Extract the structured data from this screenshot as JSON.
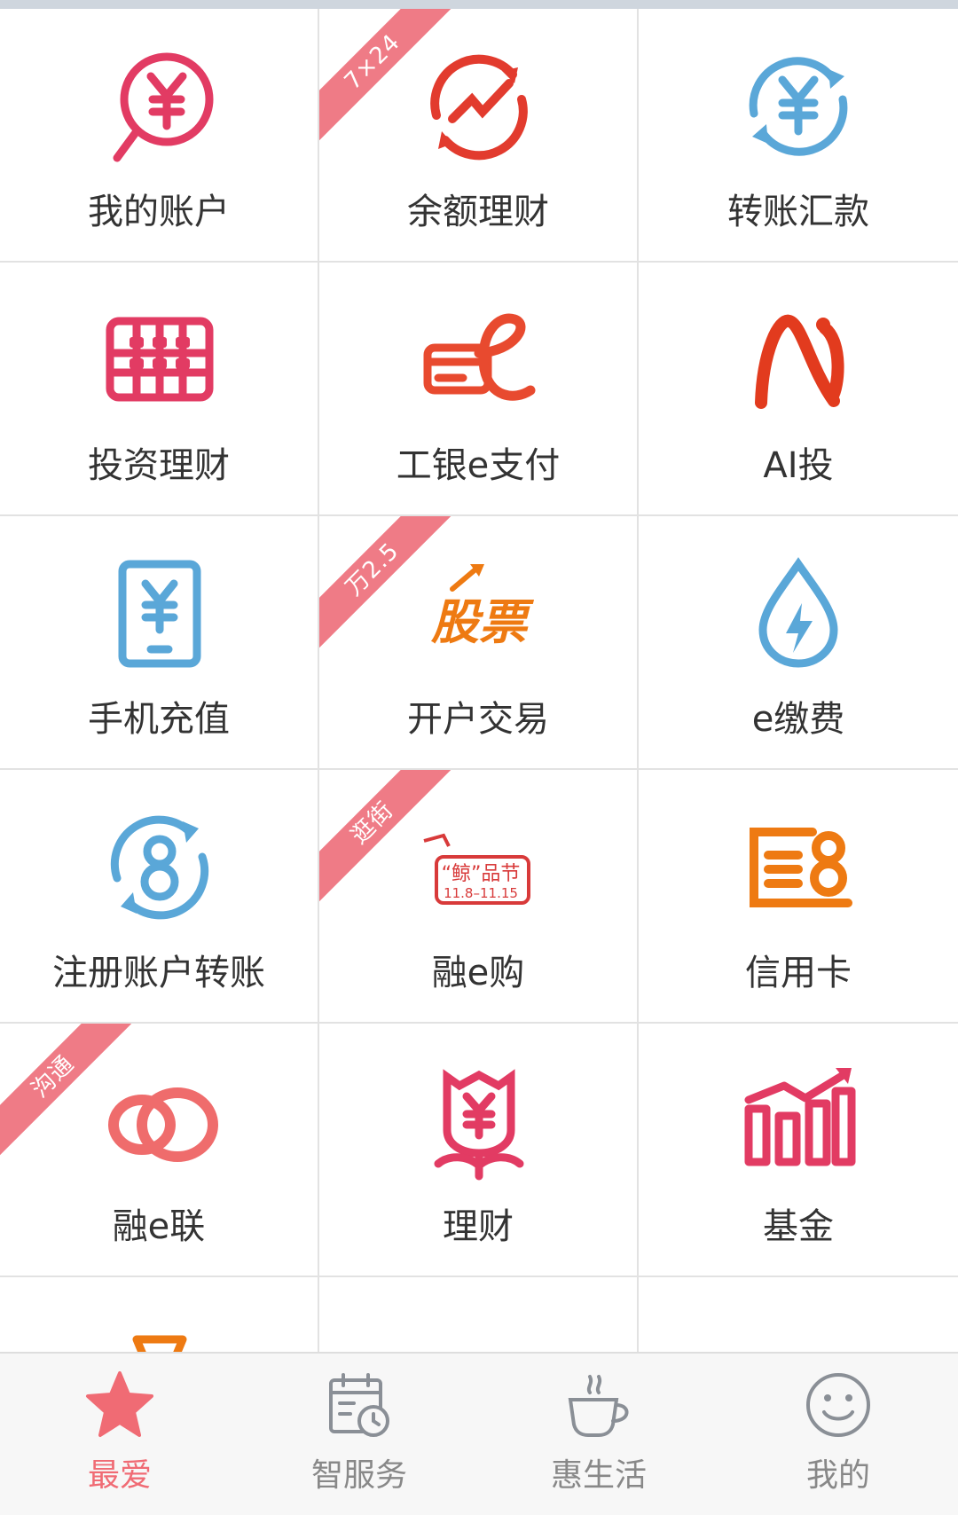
{
  "colors": {
    "accent": "#f06b74",
    "pink": "#e23b63",
    "blue": "#5aa7d8",
    "orange": "#ee7a12",
    "gray": "#888888"
  },
  "grid": {
    "items": [
      {
        "label": "我的账户",
        "icon": "yen-search-icon"
      },
      {
        "label": "余额理财",
        "icon": "trend-cycle-icon",
        "ribbon": "7×24"
      },
      {
        "label": "转账汇款",
        "icon": "yen-transfer-icon"
      },
      {
        "label": "投资理财",
        "icon": "abacus-icon"
      },
      {
        "label": "工银e支付",
        "icon": "card-e-icon"
      },
      {
        "label": "AI投",
        "icon": "ai-logo-icon"
      },
      {
        "label": "手机充值",
        "icon": "phone-yen-icon"
      },
      {
        "label": "开户交易",
        "icon": "stock-icon",
        "ribbon": "万2.5",
        "icon_text": "股票"
      },
      {
        "label": "e缴费",
        "icon": "water-bolt-icon"
      },
      {
        "label": "注册账户转账",
        "icon": "eight-cycle-icon"
      },
      {
        "label": "融e购",
        "icon": "whale-festival-icon",
        "ribbon": "逛街",
        "icon_text": "“鲸”品节",
        "icon_subtext": "11.8–11.15"
      },
      {
        "label": "信用卡",
        "icon": "credit-card-icon"
      },
      {
        "label": "融e联",
        "icon": "rings-icon",
        "ribbon": "沟通"
      },
      {
        "label": "理财",
        "icon": "rose-yen-icon"
      },
      {
        "label": "基金",
        "icon": "fund-chart-icon"
      },
      {
        "label": "",
        "icon": "partial-orange-icon"
      },
      {
        "label": "",
        "icon": ""
      },
      {
        "label": "",
        "icon": ""
      }
    ]
  },
  "tabbar": {
    "items": [
      {
        "label": "最爱",
        "icon": "star-icon",
        "active": true
      },
      {
        "label": "智服务",
        "icon": "calendar-clock-icon"
      },
      {
        "label": "惠生活",
        "icon": "coffee-cup-icon"
      },
      {
        "label": "我的",
        "icon": "smile-icon"
      }
    ]
  }
}
